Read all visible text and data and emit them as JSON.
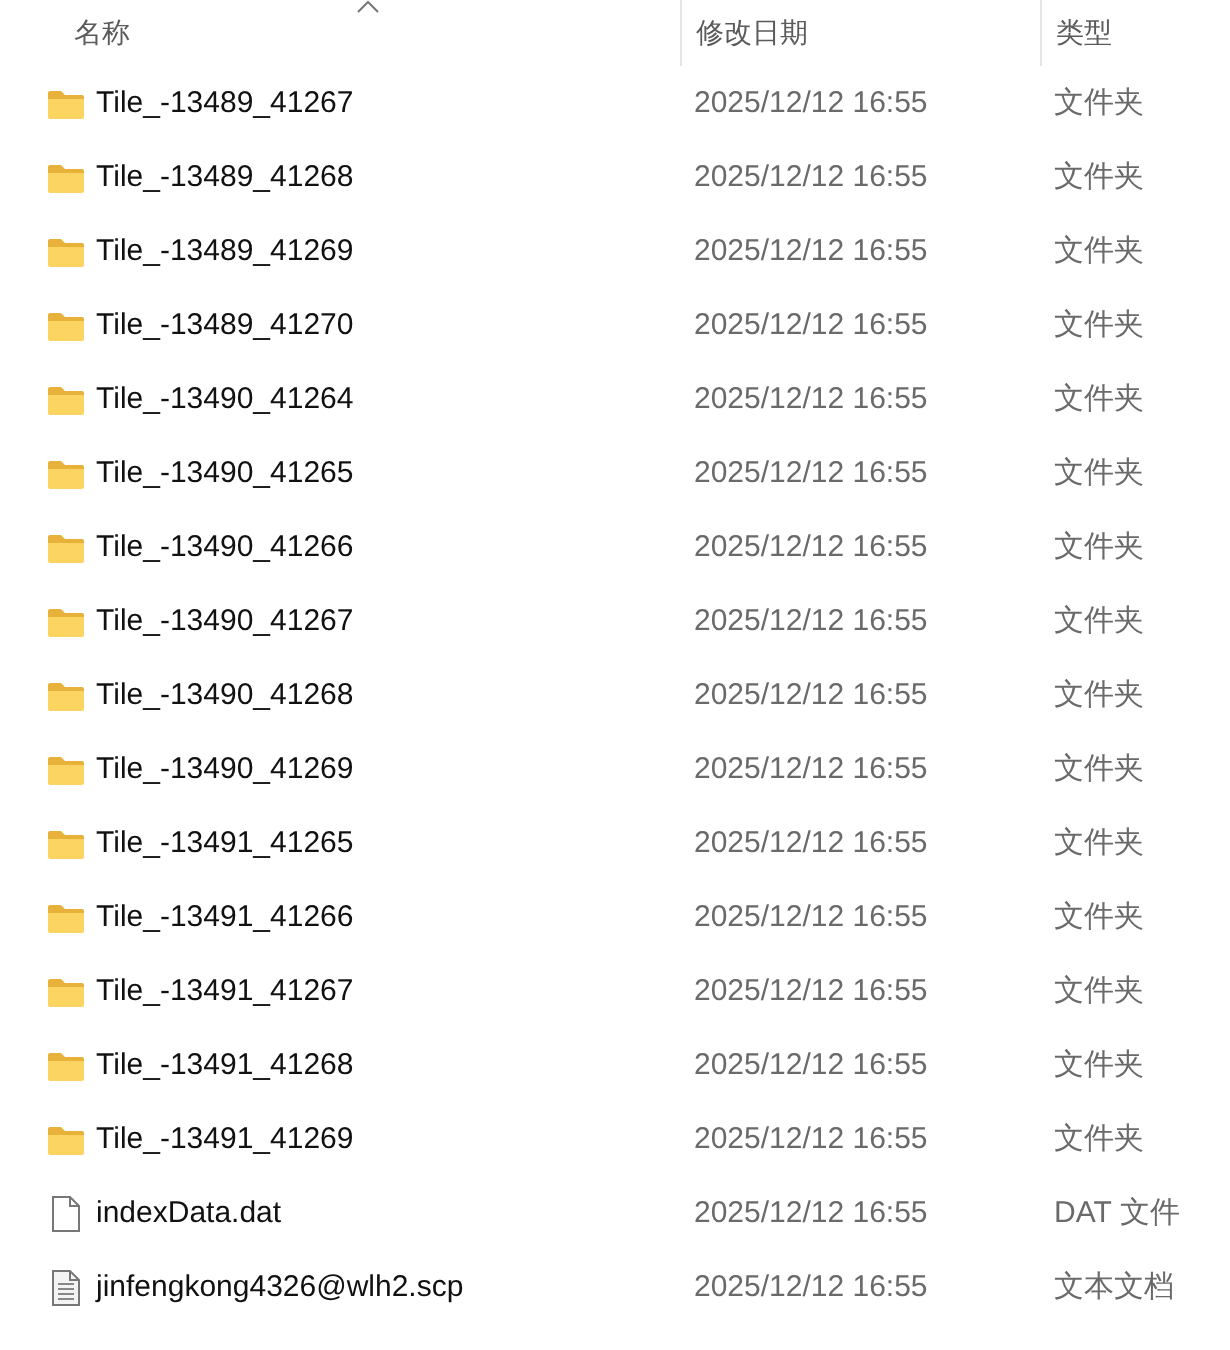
{
  "columns": [
    {
      "label": "名称",
      "sorted": true
    },
    {
      "label": "修改日期",
      "sorted": false
    },
    {
      "label": "类型",
      "sorted": false
    }
  ],
  "files": [
    {
      "kind": "folder",
      "name": "Tile_-13489_41267",
      "modified": "2025/12/12 16:55",
      "type": "文件夹"
    },
    {
      "kind": "folder",
      "name": "Tile_-13489_41268",
      "modified": "2025/12/12 16:55",
      "type": "文件夹"
    },
    {
      "kind": "folder",
      "name": "Tile_-13489_41269",
      "modified": "2025/12/12 16:55",
      "type": "文件夹"
    },
    {
      "kind": "folder",
      "name": "Tile_-13489_41270",
      "modified": "2025/12/12 16:55",
      "type": "文件夹"
    },
    {
      "kind": "folder",
      "name": "Tile_-13490_41264",
      "modified": "2025/12/12 16:55",
      "type": "文件夹"
    },
    {
      "kind": "folder",
      "name": "Tile_-13490_41265",
      "modified": "2025/12/12 16:55",
      "type": "文件夹"
    },
    {
      "kind": "folder",
      "name": "Tile_-13490_41266",
      "modified": "2025/12/12 16:55",
      "type": "文件夹"
    },
    {
      "kind": "folder",
      "name": "Tile_-13490_41267",
      "modified": "2025/12/12 16:55",
      "type": "文件夹"
    },
    {
      "kind": "folder",
      "name": "Tile_-13490_41268",
      "modified": "2025/12/12 16:55",
      "type": "文件夹"
    },
    {
      "kind": "folder",
      "name": "Tile_-13490_41269",
      "modified": "2025/12/12 16:55",
      "type": "文件夹"
    },
    {
      "kind": "folder",
      "name": "Tile_-13491_41265",
      "modified": "2025/12/12 16:55",
      "type": "文件夹"
    },
    {
      "kind": "folder",
      "name": "Tile_-13491_41266",
      "modified": "2025/12/12 16:55",
      "type": "文件夹"
    },
    {
      "kind": "folder",
      "name": "Tile_-13491_41267",
      "modified": "2025/12/12 16:55",
      "type": "文件夹"
    },
    {
      "kind": "folder",
      "name": "Tile_-13491_41268",
      "modified": "2025/12/12 16:55",
      "type": "文件夹"
    },
    {
      "kind": "folder",
      "name": "Tile_-13491_41269",
      "modified": "2025/12/12 16:55",
      "type": "文件夹"
    },
    {
      "kind": "file",
      "name": "indexData.dat",
      "modified": "2025/12/12 16:55",
      "type": "DAT 文件"
    },
    {
      "kind": "text",
      "name": "jinfengkong4326@wlh2.scp",
      "modified": "2025/12/12 16:55",
      "type": "文本文档"
    }
  ]
}
